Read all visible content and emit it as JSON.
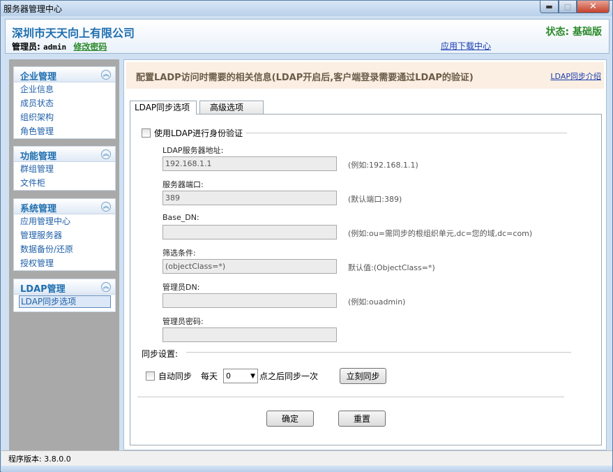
{
  "window": {
    "title": "服务器管理中心",
    "min_label": "▬",
    "max_label": "□",
    "close_label": "✕"
  },
  "header": {
    "company": "深圳市天天向上有限公司",
    "admin_label": "管理员:",
    "admin_name": "admin",
    "change_password": "修改密码",
    "download_center": "应用下载中心",
    "status": "状态: 基础版"
  },
  "sidebar": {
    "collapse_icon": "︽",
    "panels": [
      {
        "title": "企业管理",
        "items": [
          "企业信息",
          "成员状态",
          "组织架构",
          "角色管理"
        ]
      },
      {
        "title": "功能管理",
        "items": [
          "群组管理",
          "文件柜"
        ]
      },
      {
        "title": "系统管理",
        "items": [
          "应用管理中心",
          "管理服务器",
          "数据备份/还原",
          "授权管理"
        ]
      },
      {
        "title": "LDAP管理",
        "items": [
          "LDAP同步选项"
        ]
      }
    ]
  },
  "main": {
    "info_text": "配置LADP访问时需要的相关信息(LDAP开启后,客户端登录需要通过LDAP的验证)",
    "info_link": "LDAP同步介绍",
    "tabs": [
      "LDAP同步选项",
      "高级选项"
    ],
    "use_ldap_label": "使用LDAP进行身份验证",
    "fields": [
      {
        "label": "LDAP服务器地址:",
        "value": "192.168.1.1",
        "hint": "(例如:192.168.1.1)"
      },
      {
        "label": "服务器端口:",
        "value": "389",
        "hint": "(默认端口:389)"
      },
      {
        "label": "Base_DN:",
        "value": "",
        "hint": "(例如:ou=需同步的根组织单元,dc=您的域,dc=com)"
      },
      {
        "label": "筛选条件:",
        "value": "(objectClass=*)",
        "hint": "默认值:(ObjectClass=*)"
      },
      {
        "label": "管理员DN:",
        "value": "",
        "hint": "(例如:ouadmin)"
      },
      {
        "label": "管理员密码:",
        "value": "",
        "hint": ""
      }
    ],
    "sync_title": "同步设置:",
    "auto_sync_label": "自动同步",
    "every_day_label": "每天",
    "hour_value": "0",
    "after_label": "点之后同步一次",
    "sync_now_button": "立刻同步",
    "confirm_button": "确定",
    "reset_button": "重置"
  },
  "statusbar": {
    "version": "程序版本: 3.8.0.0"
  }
}
